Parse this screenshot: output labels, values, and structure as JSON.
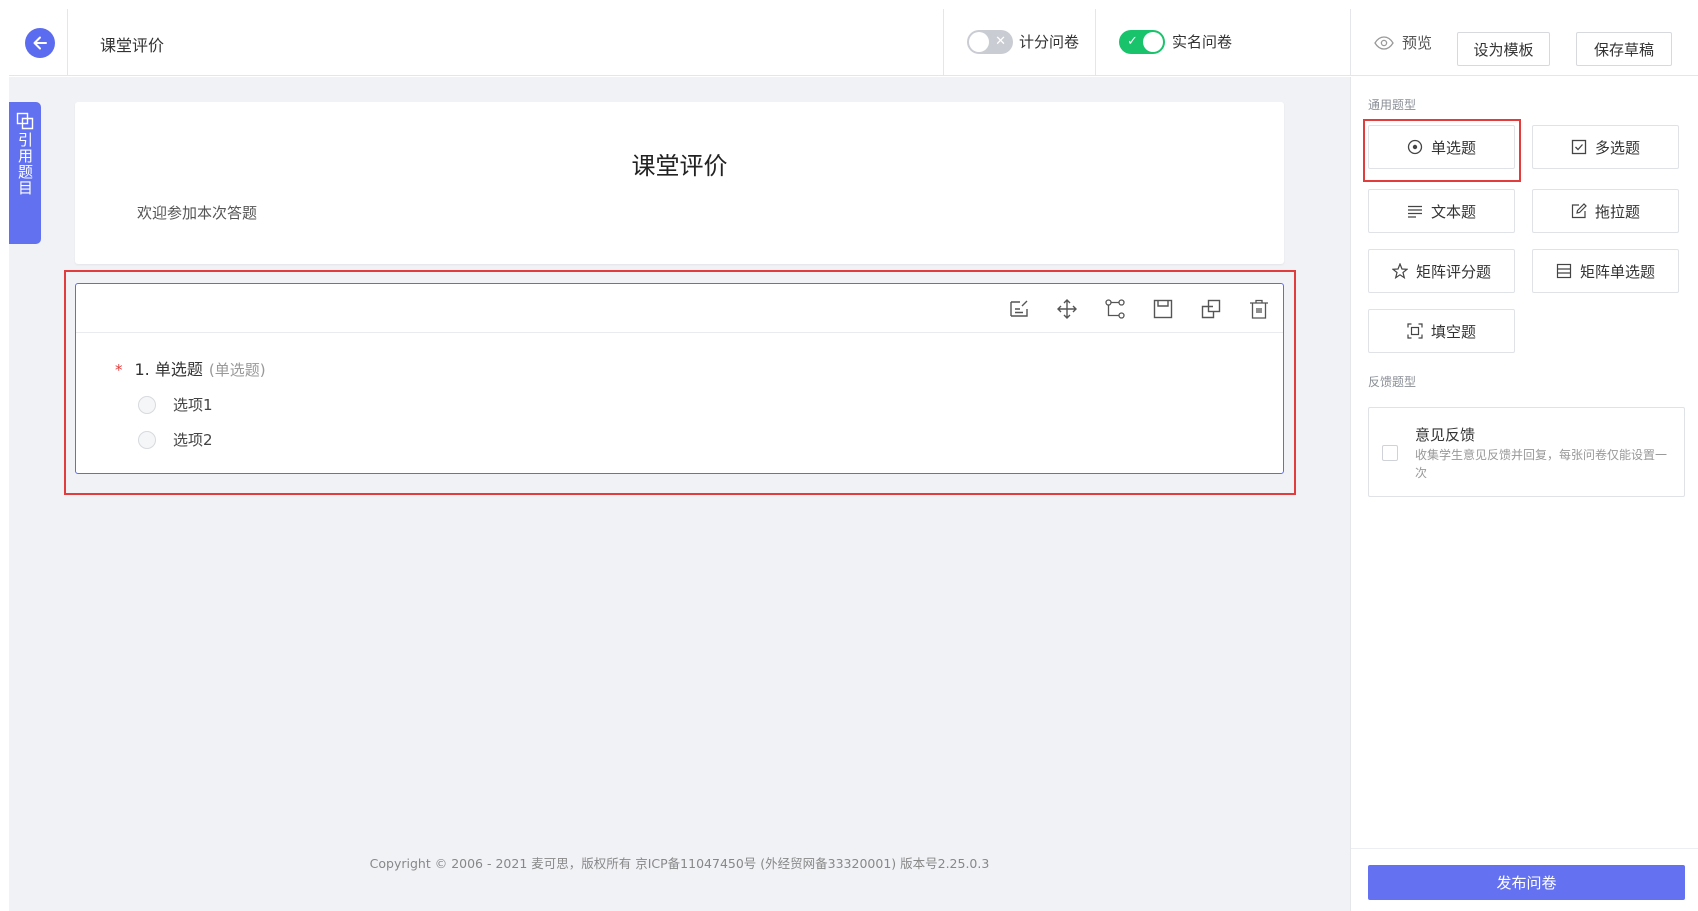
{
  "header": {
    "page_name": "课堂评价",
    "score_toggle": {
      "label": "计分问卷",
      "state": "off",
      "mark": "✕"
    },
    "realname_toggle": {
      "label": "实名问卷",
      "state": "on",
      "mark": "✓"
    },
    "preview_label": "预览",
    "template_button": "设为模板",
    "save_draft_button": "保存草稿"
  },
  "ref_tab": {
    "label": "引用题目"
  },
  "survey": {
    "title": "课堂评价",
    "welcome": "欢迎参加本次答题"
  },
  "question": {
    "required_mark": "*",
    "title": "1. 单选题",
    "type_hint": "(单选题)",
    "options": [
      "选项1",
      "选项2"
    ],
    "tools": [
      "edit-icon",
      "move-icon",
      "logic-icon",
      "save-icon",
      "copy-icon",
      "delete-icon"
    ]
  },
  "copyright": "Copyright © 2006 - 2021 麦可思，版权所有 京ICP备11047450号 (外经贸网备33320001) 版本号2.25.0.3",
  "panel": {
    "general_label": "通用题型",
    "types": [
      {
        "label": "单选题",
        "icon": "radio-icon"
      },
      {
        "label": "多选题",
        "icon": "checkbox-icon"
      },
      {
        "label": "文本题",
        "icon": "text-lines-icon"
      },
      {
        "label": "拖拉题",
        "icon": "edit-box-icon"
      },
      {
        "label": "矩阵评分题",
        "icon": "star-icon"
      },
      {
        "label": "矩阵单选题",
        "icon": "matrix-icon"
      },
      {
        "label": "填空题",
        "icon": "fill-blank-icon"
      }
    ],
    "feedback_label": "反馈题型",
    "feedback": {
      "title": "意见反馈",
      "desc": "收集学生意见反馈并回复，每张问卷仅能设置一次"
    },
    "publish_button": "发布问卷"
  },
  "colors": {
    "accent": "#5b6cf0",
    "toggle_on": "#18c36b",
    "highlight": "#e23d3d",
    "canvas_bg": "#f1f2f6"
  }
}
